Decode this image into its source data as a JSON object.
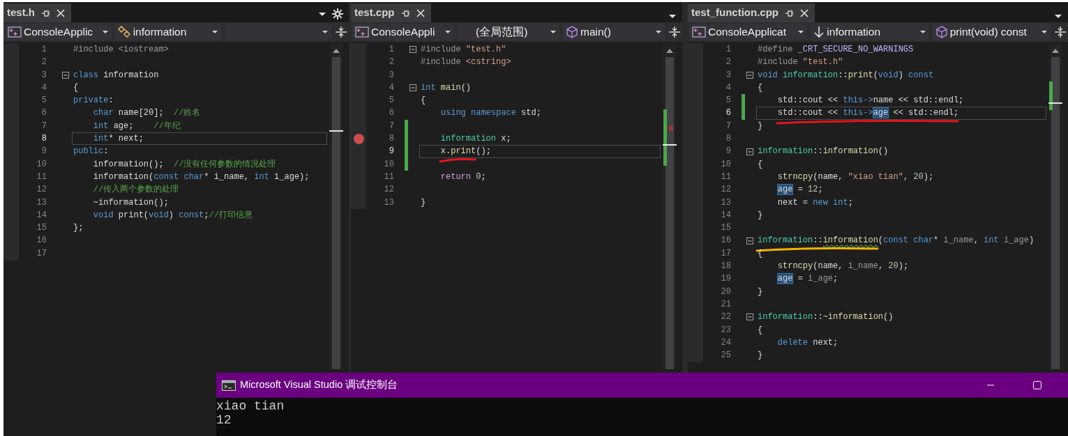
{
  "panes": [
    {
      "tab": {
        "title": "test.h"
      },
      "settings_button": true,
      "nav": [
        {
          "kind": "project",
          "text": "ConsoleApplic"
        },
        {
          "kind": "class",
          "text": "information"
        },
        {
          "kind": "blank"
        }
      ],
      "lines": [
        {
          "number": "1",
          "fold": false,
          "changed": false,
          "current": false,
          "breakpoint": false,
          "segments": [
            {
              "kind": "pre",
              "text": "#include <iostream>"
            }
          ]
        },
        {
          "number": "2",
          "fold": false,
          "changed": false,
          "current": false,
          "breakpoint": false
        },
        {
          "number": "3",
          "fold": true,
          "changed": false,
          "current": false,
          "breakpoint": false,
          "segments": [
            {
              "kind": "kw",
              "text": "class"
            },
            {
              "kind": "txt",
              "text": " information"
            }
          ]
        },
        {
          "number": "4",
          "fold": false,
          "changed": false,
          "current": false,
          "breakpoint": false,
          "segments": [
            {
              "kind": "txt",
              "text": "{"
            }
          ]
        },
        {
          "number": "5",
          "fold": false,
          "changed": false,
          "current": false,
          "breakpoint": false,
          "segments": [
            {
              "kind": "kw",
              "text": "private"
            },
            {
              "kind": "txt",
              "text": ":"
            }
          ]
        },
        {
          "number": "6",
          "fold": false,
          "changed": false,
          "current": false,
          "breakpoint": false,
          "segments": [
            {
              "kind": "kw",
              "text": "    char"
            },
            {
              "kind": "txt",
              "text": " name[20];  "
            },
            {
              "kind": "cmt",
              "text": "//姓名"
            }
          ]
        },
        {
          "number": "7",
          "fold": false,
          "changed": false,
          "current": false,
          "breakpoint": false,
          "segments": [
            {
              "kind": "kw",
              "text": "    int"
            },
            {
              "kind": "txt",
              "text": " age;    "
            },
            {
              "kind": "cmt",
              "text": "//年纪"
            }
          ]
        },
        {
          "number": "8",
          "fold": false,
          "changed": false,
          "current": true,
          "breakpoint": false,
          "segments": [
            {
              "kind": "kw",
              "text": "    int"
            },
            {
              "kind": "txt",
              "text": "* next;"
            }
          ]
        },
        {
          "number": "9",
          "fold": false,
          "changed": false,
          "current": false,
          "breakpoint": false,
          "segments": [
            {
              "kind": "kw",
              "text": "public"
            },
            {
              "kind": "txt",
              "text": ":"
            }
          ]
        },
        {
          "number": "10",
          "fold": false,
          "changed": false,
          "current": false,
          "breakpoint": false,
          "segments": [
            {
              "kind": "txt",
              "text": "    information();  "
            },
            {
              "kind": "cmt",
              "text": "//没有任何参数的情况处理"
            }
          ]
        },
        {
          "number": "11",
          "fold": false,
          "changed": false,
          "current": false,
          "breakpoint": false,
          "segments": [
            {
              "kind": "txt",
              "text": "    information("
            },
            {
              "kind": "kw",
              "text": "const char"
            },
            {
              "kind": "txt",
              "text": "* i_name, "
            },
            {
              "kind": "kw",
              "text": "int"
            },
            {
              "kind": "txt",
              "text": " i_age);"
            }
          ]
        },
        {
          "number": "12",
          "fold": false,
          "changed": false,
          "current": false,
          "breakpoint": false,
          "segments": [
            {
              "kind": "cmt",
              "text": "    //传入两个参数的处理"
            }
          ]
        },
        {
          "number": "13",
          "fold": false,
          "changed": false,
          "current": false,
          "breakpoint": false,
          "segments": [
            {
              "kind": "txt",
              "text": "    ~information();"
            }
          ]
        },
        {
          "number": "14",
          "fold": false,
          "changed": false,
          "current": false,
          "breakpoint": false,
          "segments": [
            {
              "kind": "kw",
              "text": "    void"
            },
            {
              "kind": "txt",
              "text": " print("
            },
            {
              "kind": "kw",
              "text": "void"
            },
            {
              "kind": "txt",
              "text": ") "
            },
            {
              "kind": "kw",
              "text": "const"
            },
            {
              "kind": "txt",
              "text": ";"
            },
            {
              "kind": "cmt",
              "text": "//打印信息"
            }
          ]
        },
        {
          "number": "15",
          "fold": false,
          "changed": false,
          "current": false,
          "breakpoint": false,
          "segments": [
            {
              "kind": "txt",
              "text": "};"
            }
          ]
        },
        {
          "number": "16",
          "fold": false,
          "changed": false,
          "current": false,
          "breakpoint": false
        },
        {
          "number": "17",
          "fold": false,
          "changed": false,
          "current": false,
          "breakpoint": false
        }
      ]
    },
    {
      "tab": {
        "title": "test.cpp"
      },
      "settings_button": false,
      "nav": [
        {
          "kind": "project",
          "text": "ConsoleAppli"
        },
        {
          "kind": "scope",
          "text": "(全局范围)"
        },
        {
          "kind": "method",
          "text": "main()"
        }
      ],
      "lines": [
        {
          "number": "1",
          "fold": true,
          "changed": false,
          "current": false,
          "breakpoint": false,
          "segments": [
            {
              "kind": "pre",
              "text": "#include "
            },
            {
              "kind": "str",
              "text": "\"test.h\""
            }
          ]
        },
        {
          "number": "2",
          "fold": false,
          "changed": false,
          "current": false,
          "breakpoint": false,
          "segments": [
            {
              "kind": "pre",
              "text": "#include "
            },
            {
              "kind": "str",
              "text": "<cstring>"
            }
          ]
        },
        {
          "number": "3",
          "fold": false,
          "changed": false,
          "current": false,
          "breakpoint": false
        },
        {
          "number": "4",
          "fold": true,
          "changed": false,
          "current": false,
          "breakpoint": false,
          "segments": [
            {
              "kind": "kw",
              "text": "int"
            },
            {
              "kind": "fn",
              "text": " main"
            },
            {
              "kind": "txt",
              "text": "()"
            }
          ]
        },
        {
          "number": "5",
          "fold": false,
          "changed": false,
          "current": false,
          "breakpoint": false,
          "segments": [
            {
              "kind": "txt",
              "text": "{"
            }
          ]
        },
        {
          "number": "6",
          "fold": false,
          "changed": false,
          "current": false,
          "breakpoint": false,
          "segments": [
            {
              "kind": "kw",
              "text": "    using namespace"
            },
            {
              "kind": "txt",
              "text": " std;"
            }
          ]
        },
        {
          "number": "7",
          "fold": false,
          "changed": true,
          "current": false,
          "breakpoint": false
        },
        {
          "number": "8",
          "fold": false,
          "changed": true,
          "current": false,
          "breakpoint": true,
          "segments": [
            {
              "kind": "type",
              "text": "    information"
            },
            {
              "kind": "txt",
              "text": " x;"
            }
          ]
        },
        {
          "number": "9",
          "fold": false,
          "changed": true,
          "current": true,
          "breakpoint": false,
          "scribble": {
            "color": "#e3151c"
          },
          "segments": [
            {
              "kind": "txt",
              "text": "    x.",
              "underlined": true
            },
            {
              "kind": "fn",
              "text": "print",
              "underlined": true
            },
            {
              "kind": "txt",
              "text": "();"
            }
          ]
        },
        {
          "number": "10",
          "fold": false,
          "changed": true,
          "current": false,
          "breakpoint": false
        },
        {
          "number": "11",
          "fold": false,
          "changed": false,
          "current": false,
          "breakpoint": false,
          "segments": [
            {
              "kind": "ctrl",
              "text": "    return"
            },
            {
              "kind": "num",
              "text": " 0"
            },
            {
              "kind": "txt",
              "text": ";"
            }
          ]
        },
        {
          "number": "12",
          "fold": false,
          "changed": false,
          "current": false,
          "breakpoint": false
        },
        {
          "number": "13",
          "fold": false,
          "changed": false,
          "current": false,
          "breakpoint": false,
          "segments": [
            {
              "kind": "txt",
              "text": "}"
            }
          ]
        }
      ]
    },
    {
      "tab": {
        "title": "test_function.cpp"
      },
      "settings_button": false,
      "nav": [
        {
          "kind": "project",
          "text": "ConsoleApplicat"
        },
        {
          "kind": "arrow",
          "text": "information"
        },
        {
          "kind": "method",
          "text": "print(void) const"
        }
      ],
      "lines": [
        {
          "number": "1",
          "fold": false,
          "changed": false,
          "current": false,
          "breakpoint": false,
          "segments": [
            {
              "kind": "pre",
              "text": "#define "
            },
            {
              "kind": "macro",
              "text": "_CRT_SECURE_NO_WARNINGS"
            }
          ]
        },
        {
          "number": "2",
          "fold": false,
          "changed": false,
          "current": false,
          "breakpoint": false,
          "segments": [
            {
              "kind": "pre",
              "text": "#include "
            },
            {
              "kind": "str",
              "text": "\"test.h\""
            }
          ]
        },
        {
          "number": "3",
          "fold": true,
          "changed": false,
          "current": false,
          "breakpoint": false,
          "segments": [
            {
              "kind": "kw",
              "text": "void"
            },
            {
              "kind": "type",
              "text": " information"
            },
            {
              "kind": "txt",
              "text": "::"
            },
            {
              "kind": "fn",
              "text": "print"
            },
            {
              "kind": "txt",
              "text": "("
            },
            {
              "kind": "kw",
              "text": "void"
            },
            {
              "kind": "txt",
              "text": ") "
            },
            {
              "kind": "kw",
              "text": "const"
            }
          ]
        },
        {
          "number": "4",
          "fold": false,
          "changed": false,
          "current": false,
          "breakpoint": false,
          "segments": [
            {
              "kind": "txt",
              "text": "{"
            }
          ]
        },
        {
          "number": "5",
          "fold": false,
          "changed": true,
          "current": false,
          "breakpoint": false,
          "segments": [
            {
              "kind": "txt",
              "text": "    std::cout << "
            },
            {
              "kind": "kw",
              "text": "this->"
            },
            {
              "kind": "txt",
              "text": "name << std::endl;"
            }
          ]
        },
        {
          "number": "6",
          "fold": false,
          "changed": true,
          "current": true,
          "breakpoint": false,
          "scribble": {
            "color": "#e3151c"
          },
          "segments": [
            {
              "kind": "txt",
              "text": "    std::cout << ",
              "underlined": true
            },
            {
              "kind": "kw",
              "text": "this->",
              "underlined": true
            },
            {
              "kind": "hl",
              "text": "age",
              "underlined": true
            },
            {
              "kind": "txt",
              "text": " << std::endl;",
              "underlined": true
            }
          ]
        },
        {
          "number": "7",
          "fold": false,
          "changed": false,
          "current": false,
          "breakpoint": false,
          "segments": [
            {
              "kind": "txt",
              "text": "}"
            }
          ]
        },
        {
          "number": "8",
          "fold": false,
          "changed": false,
          "current": false,
          "breakpoint": false
        },
        {
          "number": "9",
          "fold": true,
          "changed": false,
          "current": false,
          "breakpoint": false,
          "segments": [
            {
              "kind": "type",
              "text": "information"
            },
            {
              "kind": "txt",
              "text": "::"
            },
            {
              "kind": "fn",
              "text": "information"
            },
            {
              "kind": "txt",
              "text": "()"
            }
          ]
        },
        {
          "number": "10",
          "fold": false,
          "changed": false,
          "current": false,
          "breakpoint": false,
          "segments": [
            {
              "kind": "txt",
              "text": "{"
            }
          ]
        },
        {
          "number": "11",
          "fold": false,
          "changed": false,
          "current": false,
          "breakpoint": false,
          "segments": [
            {
              "kind": "fn",
              "text": "    strncpy"
            },
            {
              "kind": "txt",
              "text": "(name, "
            },
            {
              "kind": "str",
              "text": "\"xiao tian\""
            },
            {
              "kind": "txt",
              "text": ", "
            },
            {
              "kind": "num",
              "text": "20"
            },
            {
              "kind": "txt",
              "text": ");"
            }
          ]
        },
        {
          "number": "12",
          "fold": false,
          "changed": false,
          "current": false,
          "breakpoint": false,
          "segments": [
            {
              "kind": "hl",
              "text": "    age"
            },
            {
              "kind": "txt",
              "text": " = "
            },
            {
              "kind": "num",
              "text": "12"
            },
            {
              "kind": "txt",
              "text": ";"
            }
          ]
        },
        {
          "number": "13",
          "fold": false,
          "changed": false,
          "current": false,
          "breakpoint": false,
          "segments": [
            {
              "kind": "txt",
              "text": "    next = "
            },
            {
              "kind": "kw",
              "text": "new int"
            },
            {
              "kind": "txt",
              "text": ";"
            }
          ]
        },
        {
          "number": "14",
          "fold": false,
          "changed": false,
          "current": false,
          "breakpoint": false,
          "segments": [
            {
              "kind": "txt",
              "text": "}"
            }
          ]
        },
        {
          "number": "15",
          "fold": false,
          "changed": false,
          "current": false,
          "breakpoint": false
        },
        {
          "number": "16",
          "fold": true,
          "changed": false,
          "current": false,
          "breakpoint": false,
          "scribble": {
            "color": "#f5b400"
          },
          "segments": [
            {
              "kind": "type",
              "text": "information",
              "underlined": true
            },
            {
              "kind": "txt",
              "text": "::",
              "underlined": true
            },
            {
              "kind": "warn",
              "text": "information",
              "underlined": true
            },
            {
              "kind": "txt",
              "text": "("
            },
            {
              "kind": "kw",
              "text": "const char"
            },
            {
              "kind": "txt",
              "text": "* "
            },
            {
              "kind": "param",
              "text": "i_name"
            },
            {
              "kind": "txt",
              "text": ", "
            },
            {
              "kind": "kw",
              "text": "int"
            },
            {
              "kind": "param",
              "text": " i_age"
            },
            {
              "kind": "txt",
              "text": ")"
            }
          ]
        },
        {
          "number": "17",
          "fold": false,
          "changed": false,
          "current": false,
          "breakpoint": false,
          "segments": [
            {
              "kind": "txt",
              "text": "{"
            }
          ]
        },
        {
          "number": "18",
          "fold": false,
          "changed": false,
          "current": false,
          "breakpoint": false,
          "segments": [
            {
              "kind": "fn",
              "text": "    strncpy"
            },
            {
              "kind": "txt",
              "text": "(name, "
            },
            {
              "kind": "param",
              "text": "i_name"
            },
            {
              "kind": "txt",
              "text": ", "
            },
            {
              "kind": "num",
              "text": "20"
            },
            {
              "kind": "txt",
              "text": ");"
            }
          ]
        },
        {
          "number": "19",
          "fold": false,
          "changed": false,
          "current": false,
          "breakpoint": false,
          "segments": [
            {
              "kind": "hl",
              "text": "    age"
            },
            {
              "kind": "txt",
              "text": " = "
            },
            {
              "kind": "param",
              "text": "i_age"
            },
            {
              "kind": "txt",
              "text": ";"
            }
          ]
        },
        {
          "number": "20",
          "fold": false,
          "changed": false,
          "current": false,
          "breakpoint": false,
          "segments": [
            {
              "kind": "txt",
              "text": "}"
            }
          ]
        },
        {
          "number": "21",
          "fold": false,
          "changed": false,
          "current": false,
          "breakpoint": false
        },
        {
          "number": "22",
          "fold": true,
          "changed": false,
          "current": false,
          "breakpoint": false,
          "segments": [
            {
              "kind": "type",
              "text": "information"
            },
            {
              "kind": "txt",
              "text": "::"
            },
            {
              "kind": "fn",
              "text": "~information"
            },
            {
              "kind": "txt",
              "text": "()"
            }
          ]
        },
        {
          "number": "23",
          "fold": false,
          "changed": false,
          "current": false,
          "breakpoint": false,
          "segments": [
            {
              "kind": "txt",
              "text": "{"
            }
          ]
        },
        {
          "number": "24",
          "fold": false,
          "changed": false,
          "current": false,
          "breakpoint": false,
          "segments": [
            {
              "kind": "kw",
              "text": "    delete"
            },
            {
              "kind": "txt",
              "text": " next;"
            }
          ]
        },
        {
          "number": "25",
          "fold": false,
          "changed": false,
          "current": false,
          "breakpoint": false,
          "segments": [
            {
              "kind": "txt",
              "text": "}"
            }
          ]
        }
      ]
    }
  ],
  "console": {
    "title": "Microsoft Visual Studio 调试控制台",
    "output": [
      "xiao tian",
      "12"
    ]
  }
}
